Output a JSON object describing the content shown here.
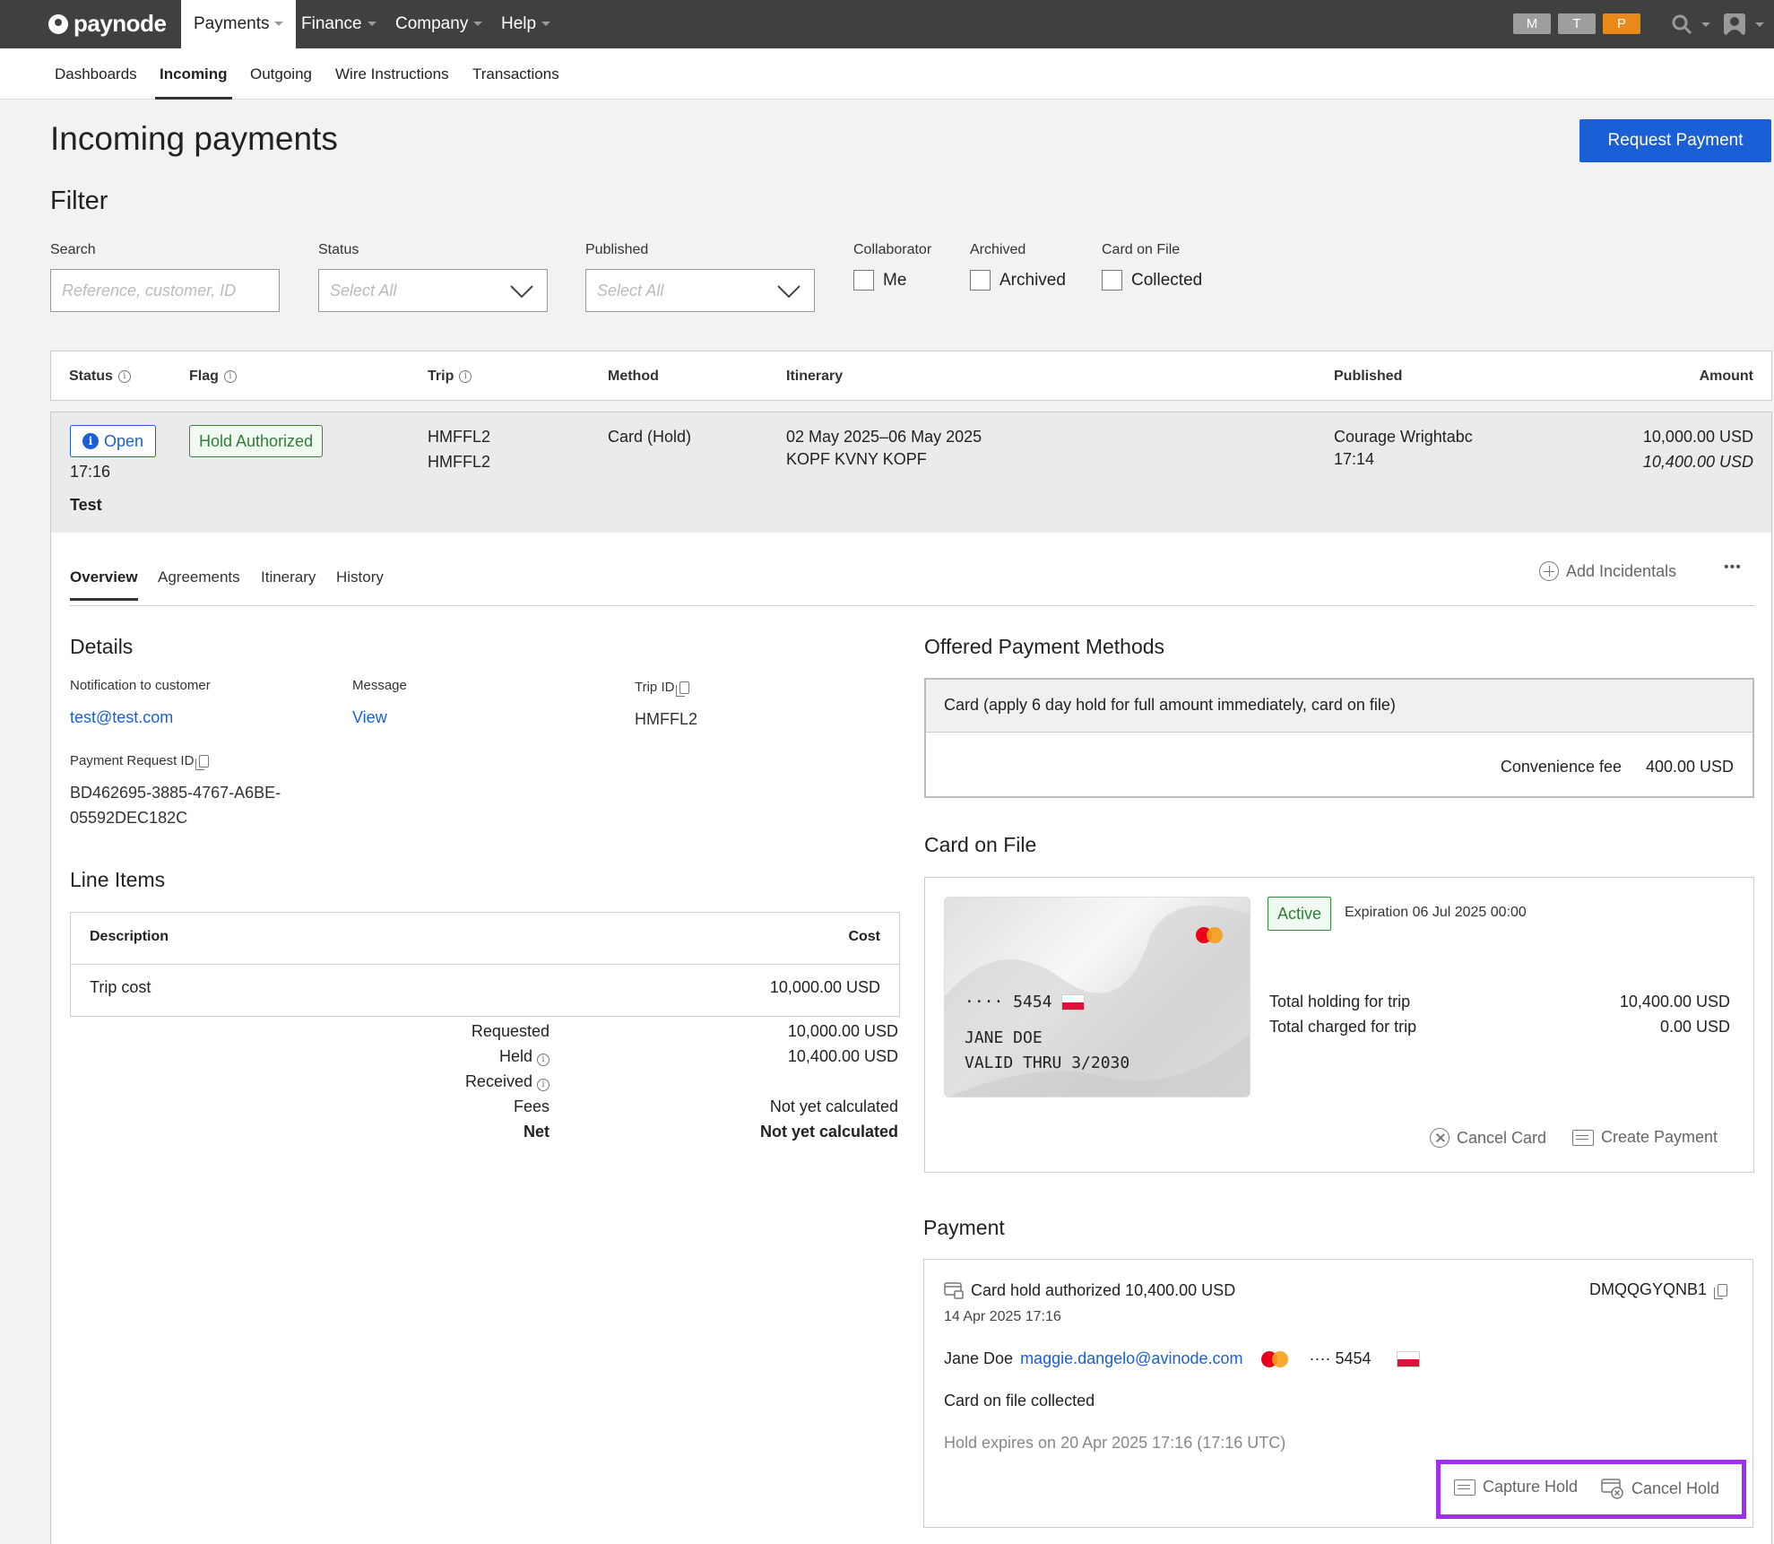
{
  "app": {
    "name": "paynode"
  },
  "topnav": {
    "items": [
      {
        "label": "Payments"
      },
      {
        "label": "Finance"
      },
      {
        "label": "Company"
      },
      {
        "label": "Help"
      }
    ],
    "env_badges": [
      "M",
      "T",
      "P"
    ],
    "env_colors": [
      "#9e9e9e",
      "#9e9e9e",
      "#e88a1a"
    ],
    "icons": [
      "search-icon",
      "user-icon"
    ]
  },
  "subnav": {
    "items": [
      {
        "label": "Dashboards"
      },
      {
        "label": "Incoming"
      },
      {
        "label": "Outgoing"
      },
      {
        "label": "Wire Instructions"
      },
      {
        "label": "Transactions"
      }
    ],
    "active": "Incoming"
  },
  "page": {
    "title": "Incoming payments",
    "request_button": "Request Payment"
  },
  "filter": {
    "title": "Filter",
    "search_label": "Search",
    "search_placeholder": "Reference, customer, ID",
    "status_label": "Status",
    "status_value": "Select All",
    "published_label": "Published",
    "published_value": "Select All",
    "collaborator_label": "Collaborator",
    "collaborator_option": "Me",
    "archived_label": "Archived",
    "archived_option": "Archived",
    "cof_label": "Card on File",
    "cof_option": "Collected"
  },
  "table": {
    "headers": {
      "status": "Status",
      "flag": "Flag",
      "trip": "Trip",
      "method": "Method",
      "itinerary": "Itinerary",
      "published": "Published",
      "amount": "Amount"
    },
    "row": {
      "status": "Open",
      "status_time": "17:16",
      "name": "Test",
      "flag": "Hold Authorized",
      "trip_1": "HMFFL2",
      "trip_2": "HMFFL2",
      "method": "Card (Hold)",
      "itinerary_dates": "02 May 2025–06 May 2025",
      "itinerary_route": "KOPF KVNY KOPF",
      "published_by": "Courage Wrightabc",
      "published_time": "17:14",
      "amount": "10,000.00 USD",
      "amount_total": "10,400.00 USD"
    }
  },
  "detail": {
    "tabs": [
      "Overview",
      "Agreements",
      "Itinerary",
      "History"
    ],
    "add_incidentals": "Add Incidentals",
    "more": "•••",
    "details_title": "Details",
    "notification_label": "Notification to customer",
    "notification_value": "test@test.com",
    "message_label": "Message",
    "message_value": "View",
    "trip_id_label": "Trip ID",
    "trip_id_value": "HMFFL2",
    "pr_id_label": "Payment Request ID",
    "pr_id_line1": "BD462695-3885-4767-A6BE-",
    "pr_id_line2": "05592DEC182C",
    "line_items_title": "Line Items",
    "li_desc_header": "Description",
    "li_cost_header": "Cost",
    "li_item_desc": "Trip cost",
    "li_item_cost": "10,000.00 USD",
    "summary": {
      "requested_label": "Requested",
      "requested_value": "10,000.00 USD",
      "held_label": "Held",
      "held_value": "10,400.00 USD",
      "received_label": "Received",
      "fees_label": "Fees",
      "fees_value": "Not yet calculated",
      "net_label": "Net",
      "net_value": "Not yet calculated"
    },
    "offered_title": "Offered Payment Methods",
    "offered_method": "Card (apply 6 day hold for full amount immediately, card on file)",
    "convenience_label": "Convenience fee",
    "convenience_value": "400.00 USD",
    "cof_title": "Card on File",
    "card_number": "···· 5454",
    "card_name": "JANE DOE",
    "card_valid": "VALID THRU 3/2030",
    "card_status": "Active",
    "card_expiration": "Expiration 06 Jul 2025 00:00",
    "total_holding_label": "Total holding for trip",
    "total_holding_value": "10,400.00 USD",
    "total_charged_label": "Total charged for trip",
    "total_charged_value": "0.00 USD",
    "cancel_card": "Cancel Card",
    "create_payment": "Create Payment",
    "payment_title": "Payment",
    "payment_status": "Card hold authorized 10,400.00 USD",
    "payment_ref": "DMQQGYQNB1",
    "payment_date": "14 Apr 2025 17:16",
    "payer_name": "Jane Doe",
    "payer_email": "maggie.dangelo@avinode.com",
    "payer_card": "···· 5454",
    "cof_collected": "Card on file collected",
    "hold_expires": "Hold expires on 20 Apr 2025 17:16 (17:16 UTC)",
    "capture_hold": "Capture Hold",
    "cancel_hold": "Cancel Hold"
  },
  "colors": {
    "accent": "#1b5fd6",
    "success": "#2f7d3a",
    "highlight": "#a12ff0"
  }
}
